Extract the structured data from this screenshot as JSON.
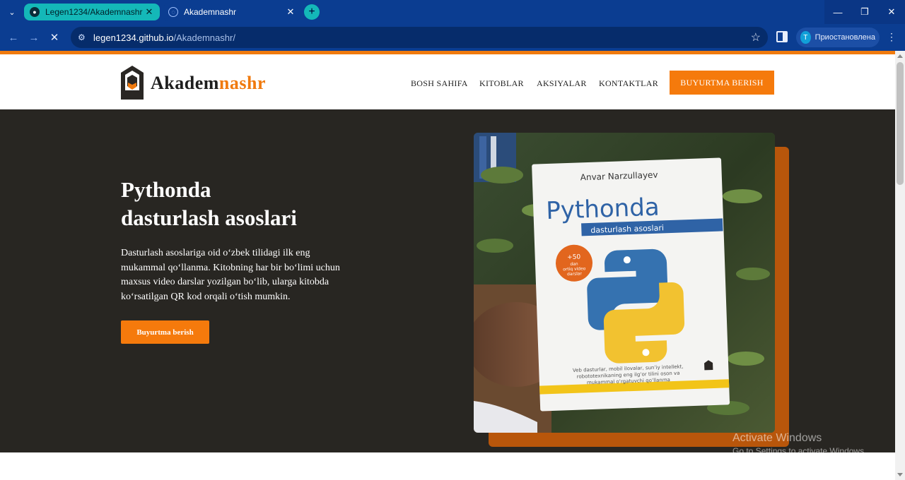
{
  "browser": {
    "tabs": [
      {
        "label": "Legen1234/Akademnashr",
        "active": true
      },
      {
        "label": "Akademnashr",
        "active": false
      }
    ],
    "url_host": "legen1234.github.io",
    "url_path": "/Akademnashr/",
    "profile_initial": "T",
    "profile_label": "Приостановлена"
  },
  "site": {
    "logo_main": "Akadem",
    "logo_accent": "nashr",
    "nav": [
      "BOSH SAHIFA",
      "KITOBLAR",
      "AKSIYALAR",
      "KONTAKTLAR"
    ],
    "cta_top": "BUYURTMA BERISH",
    "accent_color": "#f57a0c"
  },
  "hero": {
    "title_line1": "Pythonda",
    "title_line2": "dasturlash asoslari",
    "description": "Dasturlash asoslariga oid o‘zbek tilidagi ilk eng mukammal qo‘llanma. Kitobning har bir bo‘limi uchun maxsus video darslar yozilgan bo‘lib, ularga kitobda ko‘rsatilgan QR kod orqali o‘tish mumkin.",
    "cta": "Buyurtma berish",
    "book": {
      "author": "Anvar Narzullayev",
      "title": "Pythonda",
      "subtitle": "dasturlash asoslari",
      "badge_line1": "+50",
      "badge_line2": "dan",
      "badge_line3": "ortiq video",
      "badge_line4": "darslar",
      "blurb_line1": "Veb dasturlar, mobil ilovalar, sun’iy intellekt,",
      "blurb_line2": "robototexnikaning eng ilg‘or tilini oson va",
      "blurb_line3": "mukammal o‘rgatuvchi qo‘llanma"
    }
  },
  "watermark": {
    "line1": "Activate Windows",
    "line2": "Go to Settings to activate Windows."
  }
}
